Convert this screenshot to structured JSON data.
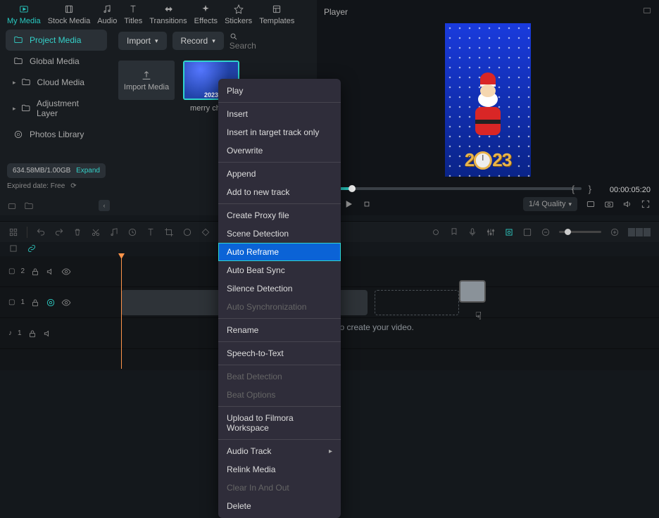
{
  "nav": {
    "my_media": "My Media",
    "stock_media": "Stock Media",
    "audio": "Audio",
    "titles": "Titles",
    "transitions": "Transitions",
    "effects": "Effects",
    "stickers": "Stickers",
    "templates": "Templates"
  },
  "sidebar": {
    "project_media": "Project Media",
    "global_media": "Global Media",
    "cloud_media": "Cloud Media",
    "adjustment_layer": "Adjustment Layer",
    "photos_library": "Photos Library"
  },
  "media_toolbar": {
    "import": "Import",
    "record": "Record",
    "search_placeholder": "Search"
  },
  "thumbs": {
    "import_media": "Import Media",
    "clip_label": "merry chri…",
    "clip_year": "2023"
  },
  "storage": {
    "used": "634.58MB/1.00GB",
    "expand": "Expand",
    "expired": "Expired date: Free"
  },
  "player": {
    "title": "Player",
    "timecode": "00:00:05:20",
    "quality": "1/4 Quality",
    "year": "2023"
  },
  "tracks": {
    "v2": "2",
    "v1": "1",
    "a1": "1",
    "drop_hint": "ffects here to create your video."
  },
  "context_menu": {
    "play": "Play",
    "insert": "Insert",
    "insert_target": "Insert in target track only",
    "overwrite": "Overwrite",
    "append": "Append",
    "add_new_track": "Add to new track",
    "create_proxy": "Create Proxy file",
    "scene_detection": "Scene Detection",
    "auto_reframe": "Auto Reframe",
    "auto_beat_sync": "Auto Beat Sync",
    "silence_detection": "Silence Detection",
    "auto_sync": "Auto Synchronization",
    "rename": "Rename",
    "speech_to_text": "Speech-to-Text",
    "beat_detection": "Beat Detection",
    "beat_options": "Beat Options",
    "upload_workspace": "Upload to Filmora Workspace",
    "audio_track": "Audio Track",
    "relink_media": "Relink Media",
    "clear_in_out": "Clear In And Out",
    "delete": "Delete"
  }
}
